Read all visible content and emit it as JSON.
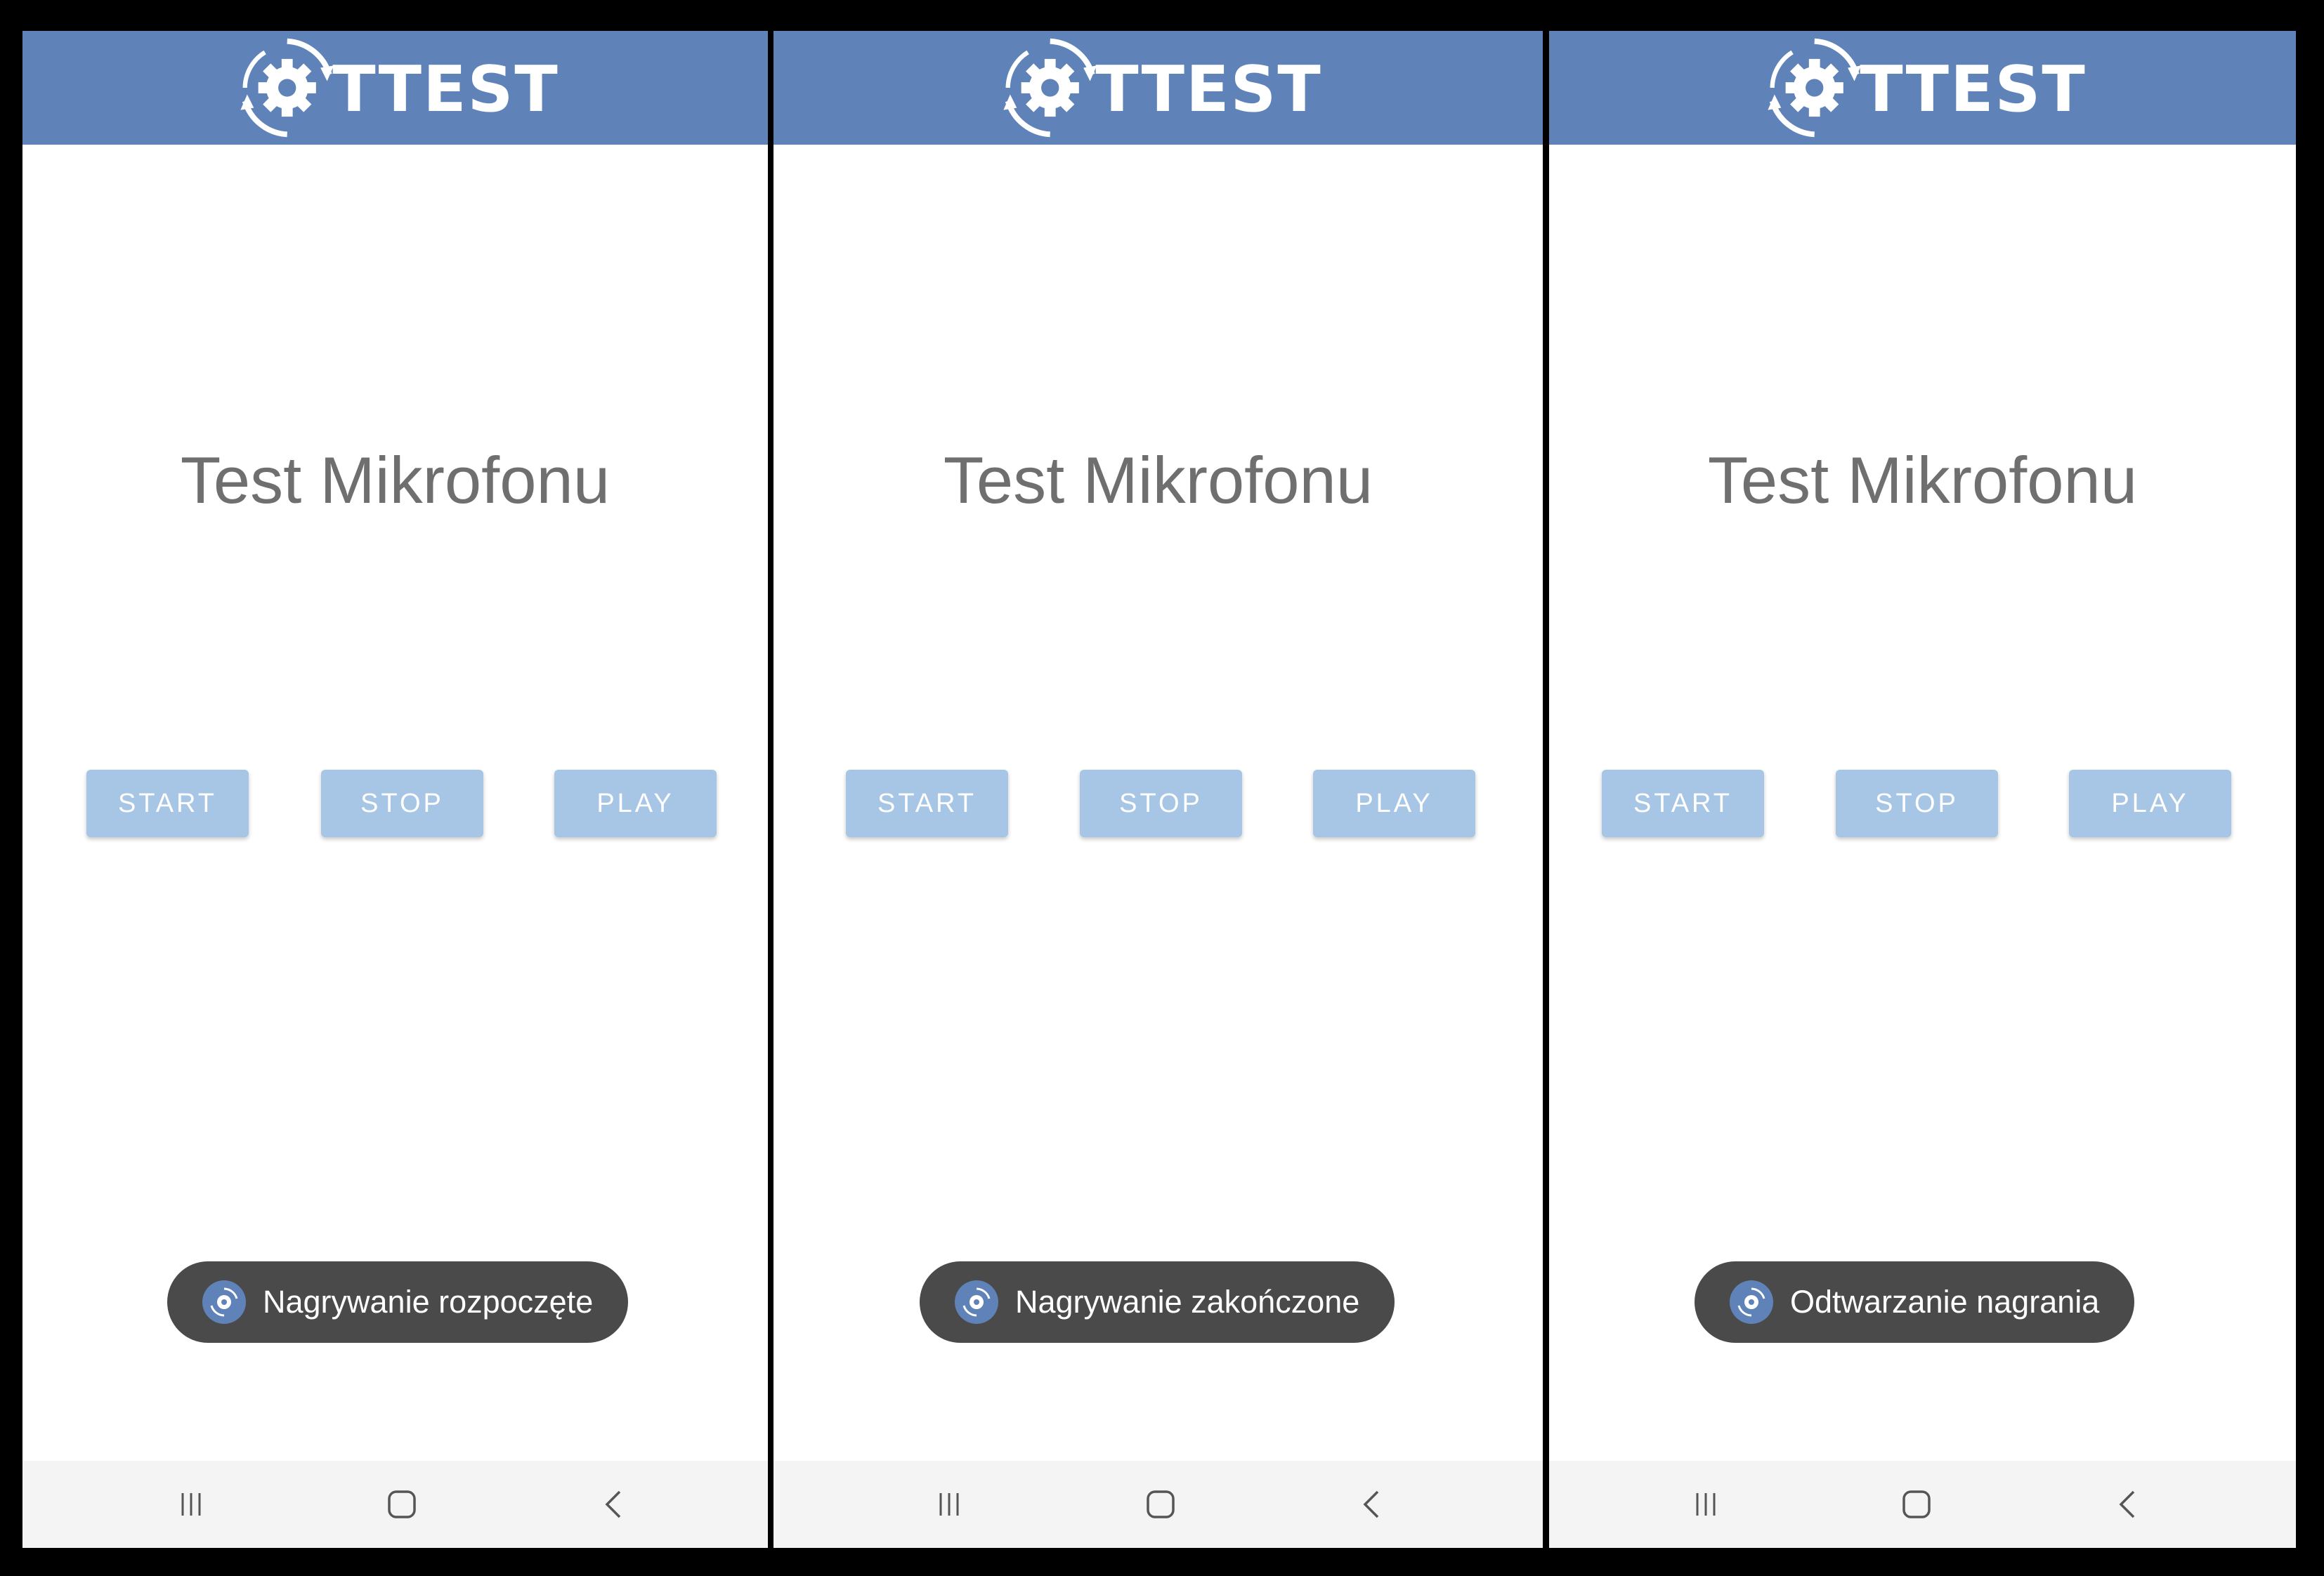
{
  "colors": {
    "app_bar": "#5f83b9",
    "button_bg": "#a7c5e5",
    "button_text": "#ffffff",
    "title_text": "#6f6f6f",
    "toast_bg": "#4a4a4a",
    "nav_bar_bg": "#f4f4f4",
    "frame_bg": "#000000"
  },
  "screens": [
    {
      "logo_text": "TTEST",
      "title": "Test Mikrofonu",
      "buttons": {
        "start": "START",
        "stop": "STOP",
        "play": "PLAY"
      },
      "toast": {
        "icon": "app-gear-icon",
        "message": "Nagrywanie rozpoczęte"
      },
      "nav": {
        "recents": "recents-icon",
        "home": "home-icon",
        "back": "back-icon"
      }
    },
    {
      "logo_text": "TTEST",
      "title": "Test Mikrofonu",
      "buttons": {
        "start": "START",
        "stop": "STOP",
        "play": "PLAY"
      },
      "toast": {
        "icon": "app-gear-icon",
        "message": "Nagrywanie zakończone"
      },
      "nav": {
        "recents": "recents-icon",
        "home": "home-icon",
        "back": "back-icon"
      }
    },
    {
      "logo_text": "TTEST",
      "title": "Test Mikrofonu",
      "buttons": {
        "start": "START",
        "stop": "STOP",
        "play": "PLAY"
      },
      "toast": {
        "icon": "app-gear-icon",
        "message": "Odtwarzanie nagrania"
      },
      "nav": {
        "recents": "recents-icon",
        "home": "home-icon",
        "back": "back-icon"
      }
    }
  ]
}
